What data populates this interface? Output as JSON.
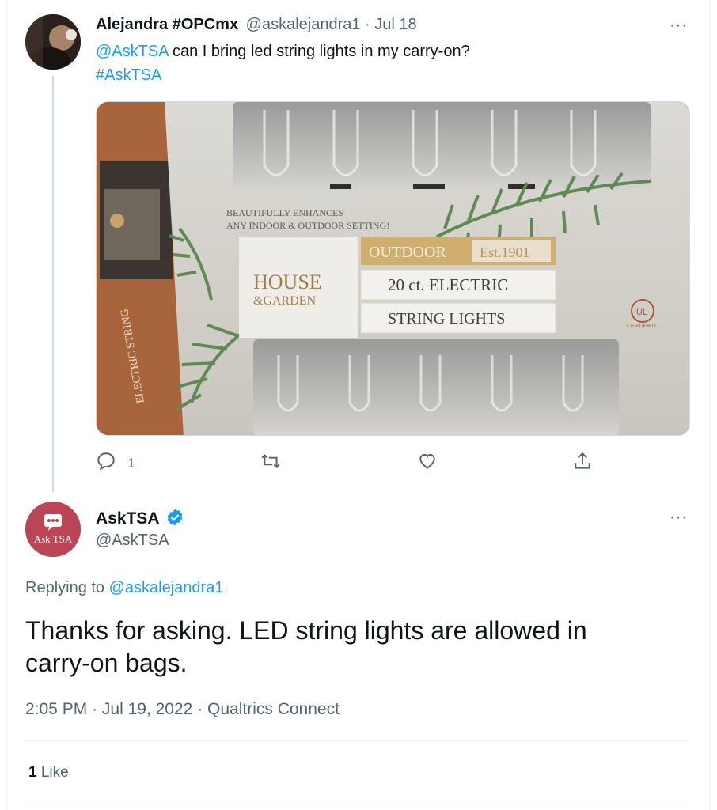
{
  "original_tweet": {
    "author_name": "Alejandra #OPCmx",
    "handle": "@askalejandra1",
    "date": "Jul 18",
    "mention": "@AskTSA",
    "text": "can I bring led string lights in my carry-on?",
    "hashtag": "#AskTSA",
    "reply_count": "1",
    "more_icon": "···",
    "image": {
      "box_lines": [
        "BEAUTIFULLY ENHANCES",
        "ANY INDOOR & OUTDOOR SETTING!"
      ],
      "brand_top": "HOUSE",
      "brand_bottom": "&GARDEN",
      "label_outdoor": "OUTDOOR",
      "label_est": "Est.1901",
      "label_count": "20 ct. ELECTRIC",
      "label_product": "STRING LIGHTS",
      "badge_ul": "UL",
      "badge_certified": "CERTIFIED",
      "side_text": "ELECTRIC STRING"
    }
  },
  "reply_tweet": {
    "author_name": "AskTSA",
    "handle": "@AskTSA",
    "avatar_text": "Ask TSA",
    "more_icon": "···",
    "replying_prefix": "Replying to",
    "replying_handle": "@askalejandra1",
    "text_line1": "Thanks for asking. LED string lights are allowed in",
    "text_line2": "carry-on bags.",
    "meta_time": "2:05 PM",
    "meta_sep": "·",
    "meta_date": "Jul 19, 2022",
    "meta_source": "Qualtrics Connect",
    "likes_count": "1",
    "likes_label": "Like"
  },
  "colors": {
    "link": "#1d9bf0",
    "muted": "#536471",
    "verified": "#1d9bf0",
    "asktsa_avatar": "#b94556"
  }
}
